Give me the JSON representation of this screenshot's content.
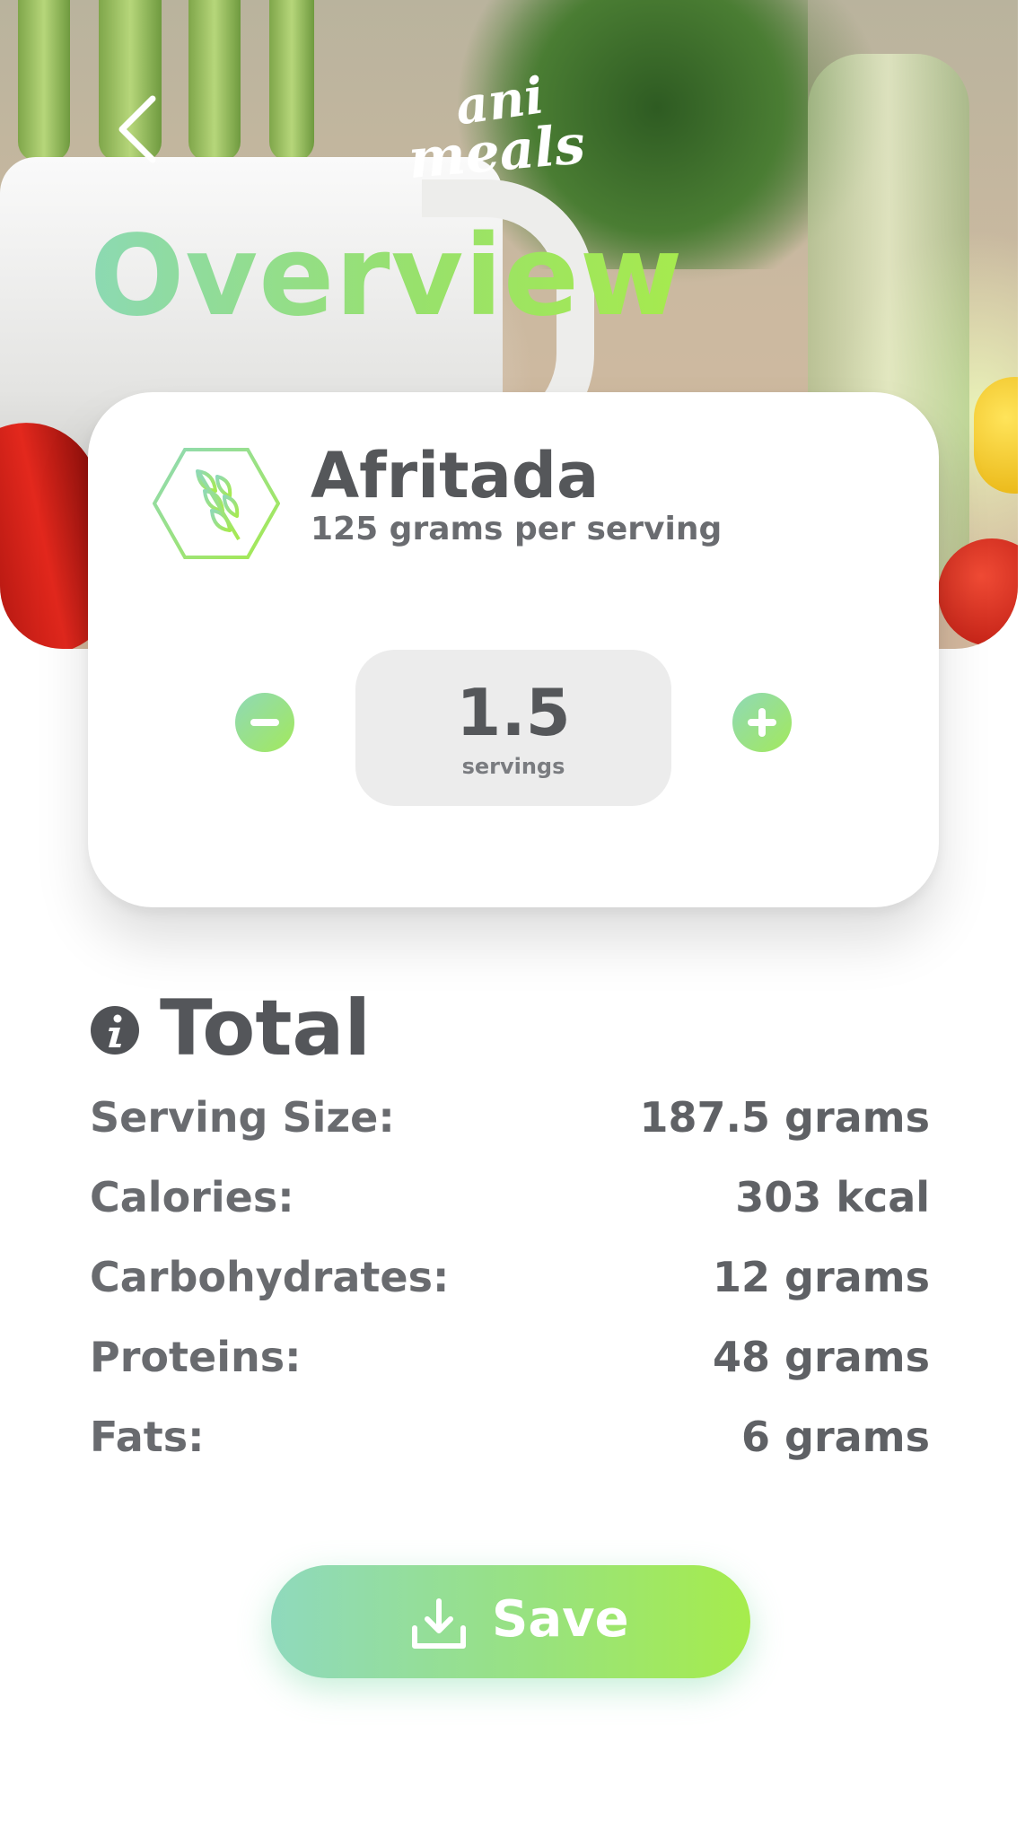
{
  "header": {
    "logo_text_top": "ani",
    "logo_text_bottom": "meals",
    "title": "Overview"
  },
  "food": {
    "name": "Afritada",
    "subtitle": "125 grams per serving",
    "icon": "wheat-hexagon-icon"
  },
  "servings": {
    "value": "1.5",
    "label": "servings"
  },
  "total": {
    "title": "Total",
    "rows": [
      {
        "label": "Serving Size:",
        "value": "187.5 grams"
      },
      {
        "label": "Calories:",
        "value": "303 kcal"
      },
      {
        "label": "Carbohydrates:",
        "value": "12 grams"
      },
      {
        "label": "Proteins:",
        "value": "48 grams"
      },
      {
        "label": "Fats:",
        "value": "6 grams"
      }
    ]
  },
  "actions": {
    "save_label": "Save"
  },
  "colors": {
    "accent_start": "#8fd9bd",
    "accent_end": "#a6ec4c",
    "text_dark": "#55575a"
  }
}
